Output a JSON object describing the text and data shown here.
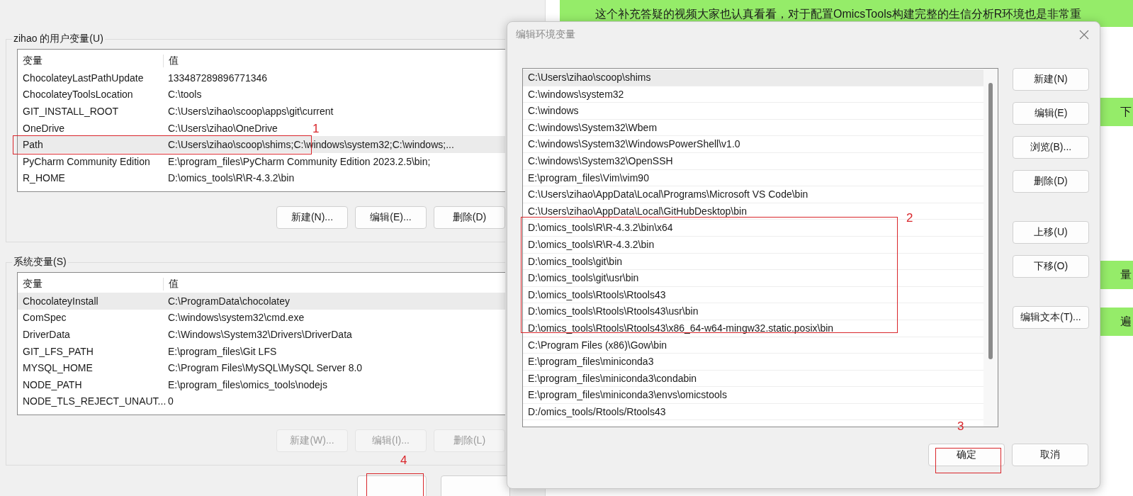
{
  "background_chat": {
    "message": "这个补充答疑的视频大家也认真看看，对于配置OmicsTools构建完整的生信分析R环境也是非常重",
    "fragments": [
      "下",
      "量",
      "遍"
    ]
  },
  "user_variables": {
    "title": "zihao 的用户变量(U)",
    "columns": [
      "变量",
      "值"
    ],
    "rows": [
      {
        "name": "ChocolateyLastPathUpdate",
        "value": "133487289896771346",
        "selected": false
      },
      {
        "name": "ChocolateyToolsLocation",
        "value": "C:\\tools",
        "selected": false
      },
      {
        "name": "GIT_INSTALL_ROOT",
        "value": "C:\\Users\\zihao\\scoop\\apps\\git\\current",
        "selected": false
      },
      {
        "name": "OneDrive",
        "value": "C:\\Users\\zihao\\OneDrive",
        "selected": false
      },
      {
        "name": "Path",
        "value": "C:\\Users\\zihao\\scoop\\shims;C:\\windows\\system32;C:\\windows;...",
        "selected": true
      },
      {
        "name": "PyCharm Community Edition",
        "value": "E:\\program_files\\PyCharm Community Edition 2023.2.5\\bin;",
        "selected": false
      },
      {
        "name": "R_HOME",
        "value": "D:\\omics_tools\\R\\R-4.3.2\\bin",
        "selected": false
      }
    ],
    "buttons": [
      {
        "label": "新建(N)...",
        "disabled": false
      },
      {
        "label": "编辑(E)...",
        "disabled": false
      },
      {
        "label": "删除(D)",
        "disabled": false
      }
    ]
  },
  "system_variables": {
    "title": "系统变量(S)",
    "columns": [
      "变量",
      "值"
    ],
    "rows": [
      {
        "name": "ChocolateyInstall",
        "value": "C:\\ProgramData\\chocolatey",
        "selected": true
      },
      {
        "name": "ComSpec",
        "value": "C:\\windows\\system32\\cmd.exe",
        "selected": false
      },
      {
        "name": "DriverData",
        "value": "C:\\Windows\\System32\\Drivers\\DriverData",
        "selected": false
      },
      {
        "name": "GIT_LFS_PATH",
        "value": "E:\\program_files\\Git LFS",
        "selected": false
      },
      {
        "name": "MYSQL_HOME",
        "value": "C:\\Program Files\\MySQL\\MySQL Server 8.0",
        "selected": false
      },
      {
        "name": "NODE_PATH",
        "value": "E:\\program_files\\omics_tools\\nodejs",
        "selected": false
      },
      {
        "name": "NODE_TLS_REJECT_UNAUT...",
        "value": "0",
        "selected": false
      }
    ],
    "buttons": [
      {
        "label": "新建(W)...",
        "disabled": true
      },
      {
        "label": "编辑(I)...",
        "disabled": true
      },
      {
        "label": "删除(L)",
        "disabled": true
      }
    ]
  },
  "edit_dialog": {
    "title": "编辑环境变量",
    "paths": [
      {
        "text": "C:\\Users\\zihao\\scoop\\shims",
        "selected": true
      },
      {
        "text": "C:\\windows\\system32",
        "selected": false
      },
      {
        "text": "C:\\windows",
        "selected": false
      },
      {
        "text": "C:\\windows\\System32\\Wbem",
        "selected": false
      },
      {
        "text": "C:\\windows\\System32\\WindowsPowerShell\\v1.0",
        "selected": false
      },
      {
        "text": "C:\\windows\\System32\\OpenSSH",
        "selected": false
      },
      {
        "text": "E:\\program_files\\Vim\\vim90",
        "selected": false
      },
      {
        "text": "C:\\Users\\zihao\\AppData\\Local\\Programs\\Microsoft VS Code\\bin",
        "selected": false
      },
      {
        "text": "C:\\Users\\zihao\\AppData\\Local\\GitHubDesktop\\bin",
        "selected": false
      },
      {
        "text": "D:\\omics_tools\\R\\R-4.3.2\\bin\\x64",
        "selected": false
      },
      {
        "text": "D:\\omics_tools\\R\\R-4.3.2\\bin",
        "selected": false
      },
      {
        "text": "D:\\omics_tools\\git\\bin",
        "selected": false
      },
      {
        "text": "D:\\omics_tools\\git\\usr\\bin",
        "selected": false
      },
      {
        "text": "D:\\omics_tools\\Rtools\\Rtools43",
        "selected": false
      },
      {
        "text": "D:\\omics_tools\\Rtools\\Rtools43\\usr\\bin",
        "selected": false
      },
      {
        "text": "D:\\omics_tools\\Rtools\\Rtools43\\x86_64-w64-mingw32.static.posix\\bin",
        "selected": false
      },
      {
        "text": "C:\\Program Files (x86)\\Gow\\bin",
        "selected": false
      },
      {
        "text": "E:\\program_files\\miniconda3",
        "selected": false
      },
      {
        "text": "E:\\program_files\\miniconda3\\condabin",
        "selected": false
      },
      {
        "text": "E:\\program_files\\miniconda3\\envs\\omicstools",
        "selected": false
      },
      {
        "text": "D:/omics_tools/Rtools/Rtools43",
        "selected": false
      }
    ],
    "side_buttons": [
      {
        "label": "新建(N)"
      },
      {
        "label": "编辑(E)"
      },
      {
        "label": "浏览(B)..."
      },
      {
        "label": "删除(D)"
      },
      {
        "label": "上移(U)"
      },
      {
        "label": "下移(O)"
      },
      {
        "label": "编辑文本(T)..."
      }
    ],
    "ok_button": "确定",
    "cancel_button": "取消"
  },
  "annotations": [
    {
      "label": "1"
    },
    {
      "label": "2"
    },
    {
      "label": "3"
    },
    {
      "label": "4"
    }
  ]
}
